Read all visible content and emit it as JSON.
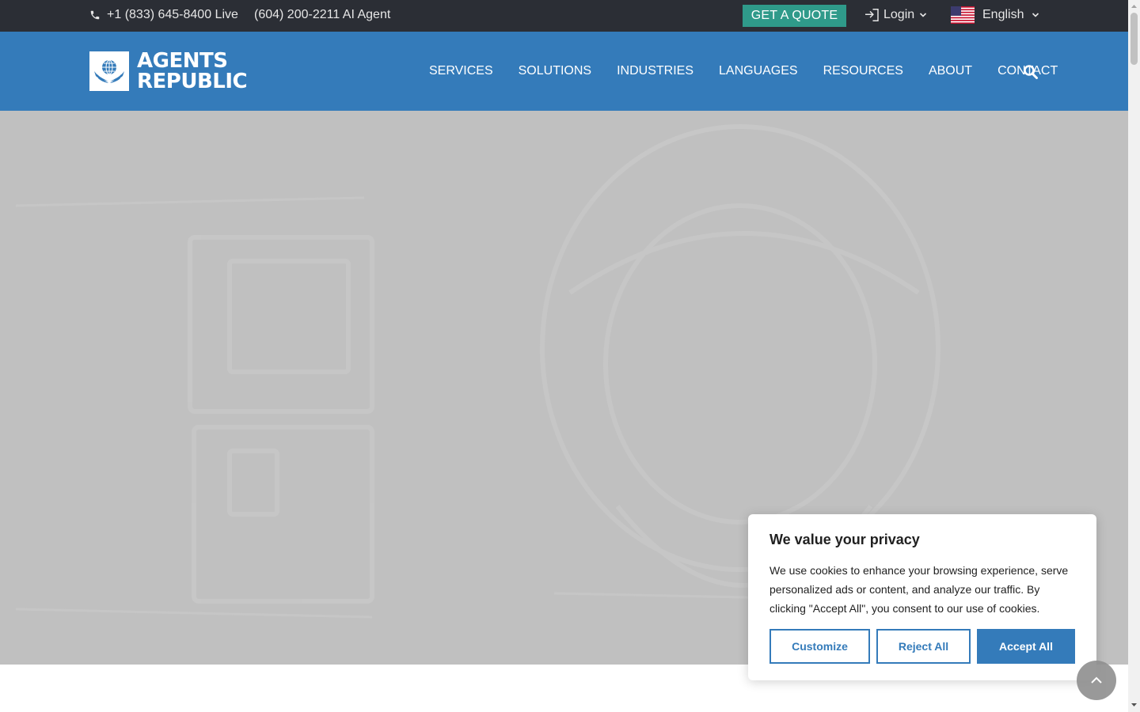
{
  "topbar": {
    "phone_live": "+1 (833) 645-8400 Live",
    "phone_ai": "(604) 200-2211 AI Agent",
    "quote_label": "GET A QUOTE",
    "login_label": "Login",
    "language_label": "English"
  },
  "header": {
    "logo_line1": "AGENTS",
    "logo_line2": "REPUBLIC",
    "nav": {
      "services": "SERVICES",
      "solutions": "SOLUTIONS",
      "industries": "INDUSTRIES",
      "languages": "LANGUAGES",
      "resources": "RESOURCES",
      "about": "ABOUT",
      "contact": "CONTACT"
    }
  },
  "cookie": {
    "title": "We value your privacy",
    "body": "We use cookies to enhance your browsing experience, serve personalized ads or content, and analyze our traffic. By clicking \"Accept All\", you consent to our use of cookies.",
    "customize_label": "Customize",
    "reject_label": "Reject All",
    "accept_label": "Accept All"
  },
  "colors": {
    "topbar_bg": "#2b2e35",
    "nav_bg": "#347bba",
    "quote_bg": "#2f9a8a",
    "hero_bg": "#c0c0c0"
  },
  "icons": [
    "phone-icon",
    "login-icon",
    "flag-us-icon",
    "chevron-down-icon",
    "search-icon",
    "chevron-up-icon",
    "globe-wings-icon"
  ]
}
